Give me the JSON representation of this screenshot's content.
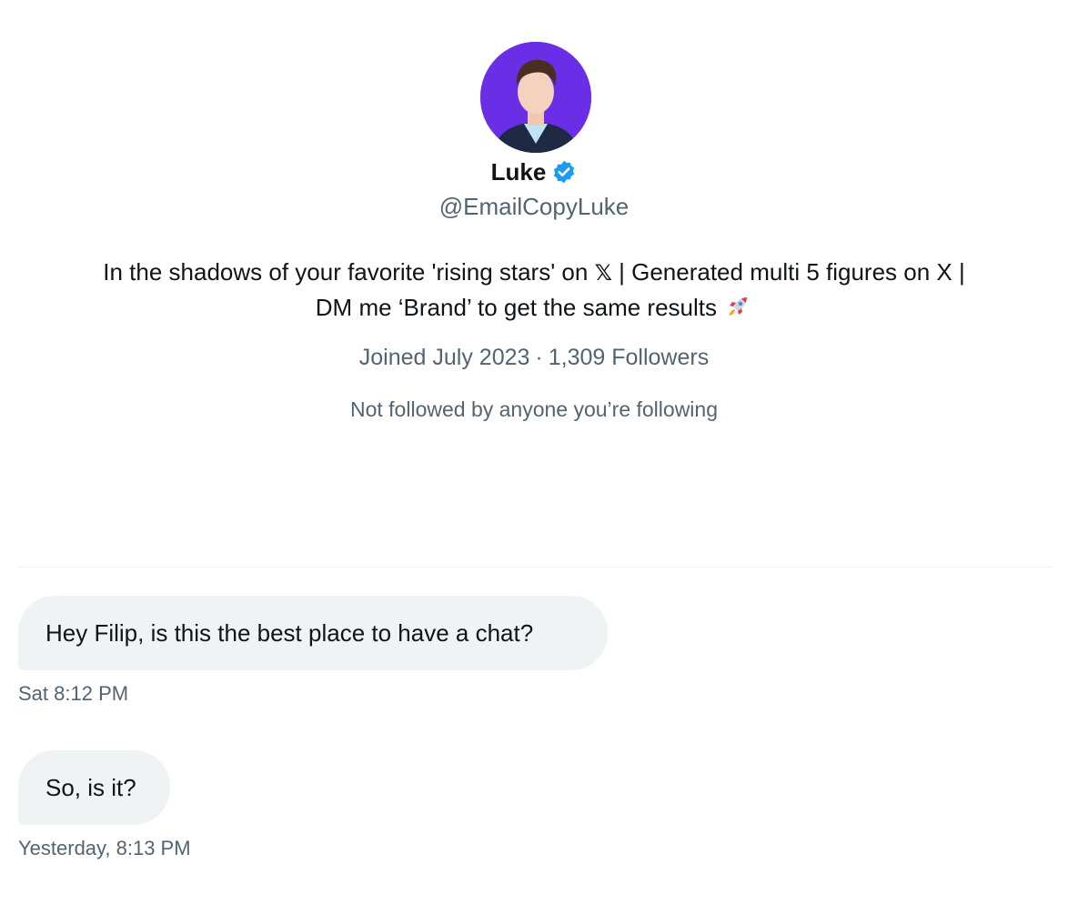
{
  "profile": {
    "name": "Luke",
    "handle": "@EmailCopyLuke",
    "verified_icon": "verified-badge-icon",
    "avatar_bg": "#6a2ee6",
    "bio": {
      "line1_part1": "In the shadows of your favorite 'rising stars' on ",
      "x_symbol": "𝕏",
      "line1_part2": " | Generated multi 5 figures on X |",
      "line2": "DM me ‘Brand’ to get the same results ",
      "emoji_icon": "rocket-icon"
    },
    "joined": "Joined July 2023",
    "separator": "·",
    "followers": "1,309 Followers",
    "mutuals": "Not followed by anyone you’re following"
  },
  "messages": [
    {
      "text": "Hey Filip, is this the best place to have a chat?",
      "timestamp": "Sat 8:12 PM"
    },
    {
      "text": "So, is it?",
      "timestamp": "Yesterday, 8:13 PM"
    }
  ],
  "colors": {
    "text_primary": "#0f1419",
    "text_secondary": "#536471",
    "bubble_bg": "#eff3f4",
    "verified_blue": "#1d9bf0"
  }
}
